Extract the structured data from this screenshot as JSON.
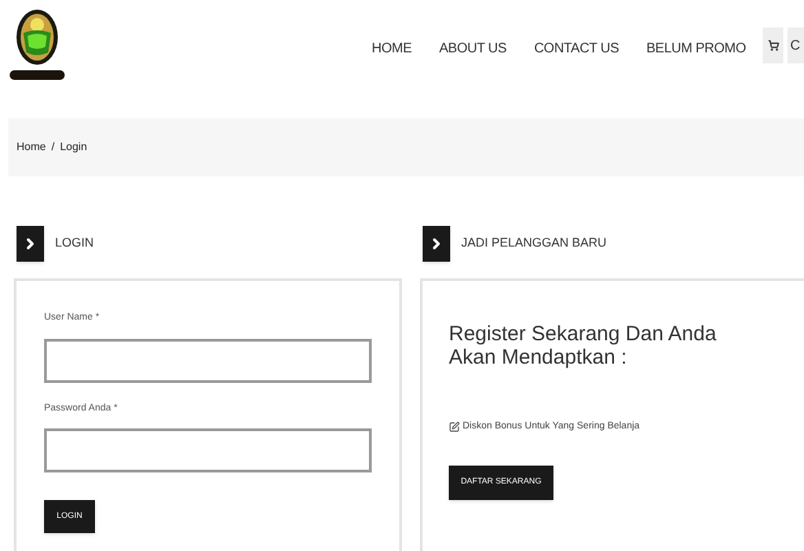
{
  "nav": {
    "items": [
      {
        "label": "HOME"
      },
      {
        "label": "ABOUT US"
      },
      {
        "label": "CONTACT US"
      },
      {
        "label": "BELUM PROMO"
      }
    ],
    "second_button": "C"
  },
  "breadcrumb": [
    "Home",
    "/",
    "Login"
  ],
  "login": {
    "title": "LOGIN",
    "fields": [
      {
        "label": "User Name *"
      },
      {
        "label": "Password Anda *"
      }
    ],
    "button": "LOGIN"
  },
  "register": {
    "title": "JADI PELANGGAN BARU",
    "heading": "Register Sekarang Dan Anda Akan Mendaptkan :",
    "benefits": [
      "Diskon Bonus Untuk Yang Sering Belanja"
    ],
    "button": "DAFTAR SEKARANG"
  }
}
